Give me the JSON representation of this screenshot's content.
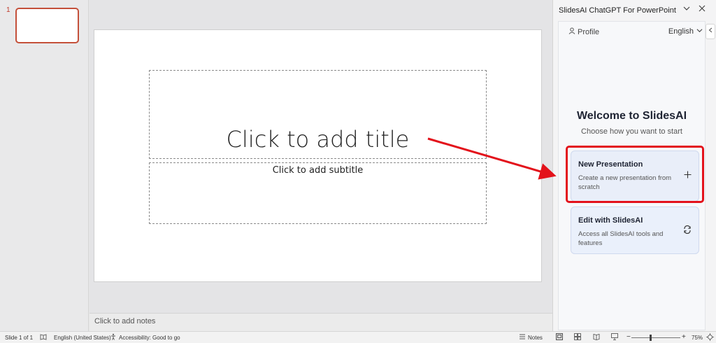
{
  "thumbnails": [
    {
      "number": "1"
    }
  ],
  "slide": {
    "title_placeholder": "Click to add title",
    "subtitle_placeholder": "Click to add subtitle"
  },
  "notes": {
    "placeholder": "Click to add notes"
  },
  "panel": {
    "title": "SlidesAI ChatGPT For PowerPoint",
    "profile_label": "Profile",
    "language": "English",
    "welcome": "Welcome to SlidesAI",
    "subtitle": "Choose how you want to start",
    "cards": [
      {
        "title": "New Presentation",
        "description": "Create a new presentation from scratch",
        "icon": "plus-icon"
      },
      {
        "title": "Edit with SlidesAI",
        "description": "Access all SlidesAI tools and features",
        "icon": "refresh-icon"
      }
    ]
  },
  "status_bar": {
    "slide_info": "Slide 1 of 1",
    "language": "English (United States)",
    "accessibility": "Accessibility: Good to go",
    "notes_label": "Notes",
    "zoom": "75%"
  },
  "colors": {
    "highlight": "#e3121b",
    "card_bg": "#e9eef9",
    "thumb_border": "#c4503a"
  }
}
